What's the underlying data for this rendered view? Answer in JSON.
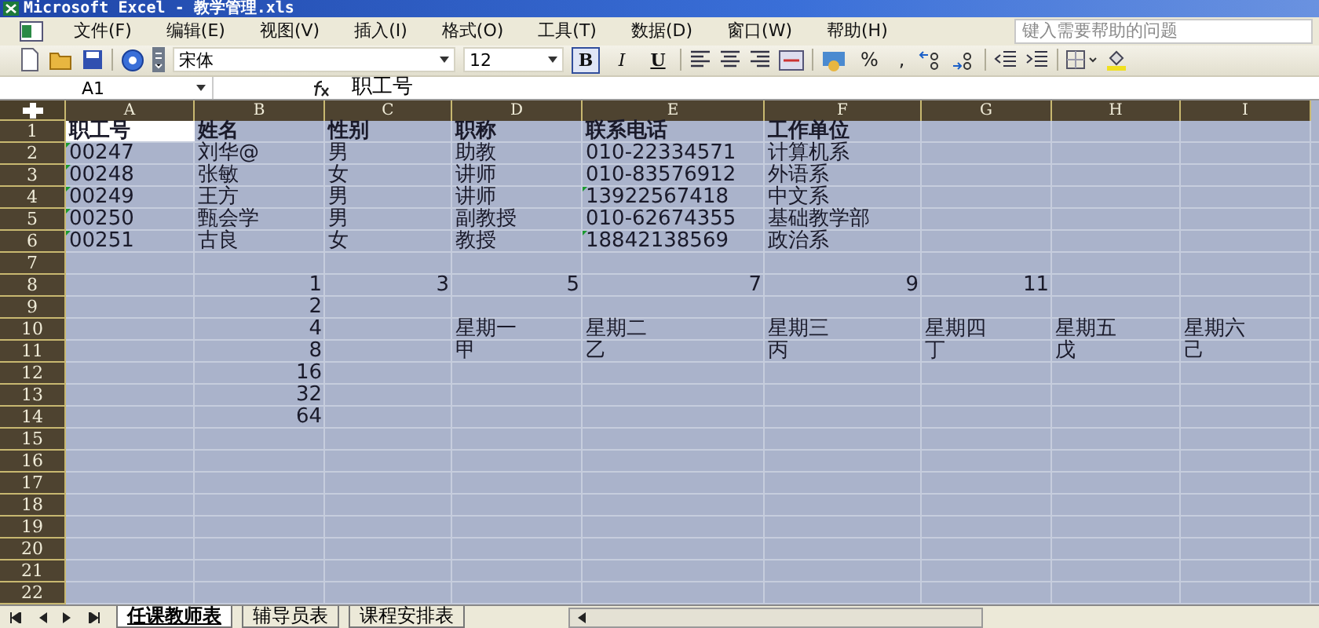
{
  "window": {
    "title": "Microsoft Excel - 教学管理.xls"
  },
  "menu": [
    "文件(F)",
    "编辑(E)",
    "视图(V)",
    "插入(I)",
    "格式(O)",
    "工具(T)",
    "数据(D)",
    "窗口(W)",
    "帮助(H)"
  ],
  "help_search": {
    "placeholder": "键入需要帮助的问题"
  },
  "toolbar": {
    "font_name": "宋体",
    "font_size": "12",
    "format_buttons": [
      {
        "label": "B",
        "on": true
      },
      {
        "label": "I",
        "on": false
      },
      {
        "label": "U",
        "on": false
      }
    ],
    "number_buttons": [
      "%",
      ","
    ]
  },
  "formula_bar": {
    "name_box": "A1",
    "content": "职工号"
  },
  "sheet": {
    "all_selected": true,
    "columns": [
      "A",
      "B",
      "C",
      "D",
      "E",
      "F",
      "G",
      "H",
      "I"
    ],
    "rows": [
      {
        "number": "1",
        "kind": "header",
        "cells": [
          {
            "text": "职工号",
            "active": true
          },
          {
            "text": "姓名"
          },
          {
            "text": "性别"
          },
          {
            "text": "职称"
          },
          {
            "text": "联系电话"
          },
          {
            "text": "工作单位"
          }
        ]
      },
      {
        "number": "2",
        "cells": [
          {
            "text": "00247",
            "flag": true
          },
          {
            "text": "刘华@"
          },
          {
            "text": "男"
          },
          {
            "text": "助教"
          },
          {
            "text": "010-22334571"
          },
          {
            "text": "计算机系"
          }
        ]
      },
      {
        "number": "3",
        "cells": [
          {
            "text": "00248",
            "flag": true
          },
          {
            "text": "张敏"
          },
          {
            "text": "女"
          },
          {
            "text": "讲师"
          },
          {
            "text": "010-83576912"
          },
          {
            "text": "外语系"
          }
        ]
      },
      {
        "number": "4",
        "cells": [
          {
            "text": "00249",
            "flag": true
          },
          {
            "text": "王方"
          },
          {
            "text": "男"
          },
          {
            "text": "讲师"
          },
          {
            "text": "13922567418",
            "flag": true
          },
          {
            "text": "中文系"
          }
        ]
      },
      {
        "number": "5",
        "cells": [
          {
            "text": "00250",
            "flag": true
          },
          {
            "text": "甄会学"
          },
          {
            "text": "男"
          },
          {
            "text": "副教授"
          },
          {
            "text": "010-62674355"
          },
          {
            "text": "基础教学部"
          }
        ]
      },
      {
        "number": "6",
        "cells": [
          {
            "text": "00251",
            "flag": true
          },
          {
            "text": "古良"
          },
          {
            "text": "女"
          },
          {
            "text": "教授"
          },
          {
            "text": "18842138569",
            "flag": true
          },
          {
            "text": "政治系"
          }
        ]
      },
      {
        "number": "7",
        "cells": []
      },
      {
        "number": "8",
        "cells": [
          null,
          {
            "text": "1",
            "kind": "number"
          },
          {
            "text": "3",
            "kind": "number"
          },
          {
            "text": "5",
            "kind": "number"
          },
          {
            "text": "7",
            "kind": "number"
          },
          {
            "text": "9",
            "kind": "number"
          },
          {
            "text": "11",
            "kind": "number"
          }
        ]
      },
      {
        "number": "9",
        "cells": [
          null,
          {
            "text": "2",
            "kind": "number"
          }
        ]
      },
      {
        "number": "10",
        "cells": [
          null,
          {
            "text": "4",
            "kind": "number"
          },
          null,
          {
            "text": "星期一"
          },
          {
            "text": "星期二"
          },
          {
            "text": "星期三"
          },
          {
            "text": "星期四"
          },
          {
            "text": "星期五"
          },
          {
            "text": "星期六"
          }
        ]
      },
      {
        "number": "11",
        "cells": [
          null,
          {
            "text": "8",
            "kind": "number"
          },
          null,
          {
            "text": "甲"
          },
          {
            "text": "乙"
          },
          {
            "text": "丙"
          },
          {
            "text": "丁"
          },
          {
            "text": "戊"
          },
          {
            "text": "己"
          }
        ]
      },
      {
        "number": "12",
        "cells": [
          null,
          {
            "text": "16",
            "kind": "number"
          }
        ]
      },
      {
        "number": "13",
        "cells": [
          null,
          {
            "text": "32",
            "kind": "number"
          }
        ]
      },
      {
        "number": "14",
        "cells": [
          null,
          {
            "text": "64",
            "kind": "number"
          }
        ]
      },
      {
        "number": "15",
        "cells": []
      },
      {
        "number": "16",
        "cells": []
      },
      {
        "number": "17",
        "cells": []
      },
      {
        "number": "18",
        "cells": []
      },
      {
        "number": "19",
        "cells": []
      },
      {
        "number": "20",
        "cells": []
      },
      {
        "number": "21",
        "cells": []
      },
      {
        "number": "22",
        "cells": []
      }
    ]
  },
  "sheet_tabs": [
    {
      "label": "任课教师表",
      "selected": true
    },
    {
      "label": "辅导员表",
      "selected": false
    },
    {
      "label": "课程安排表",
      "selected": false
    }
  ]
}
